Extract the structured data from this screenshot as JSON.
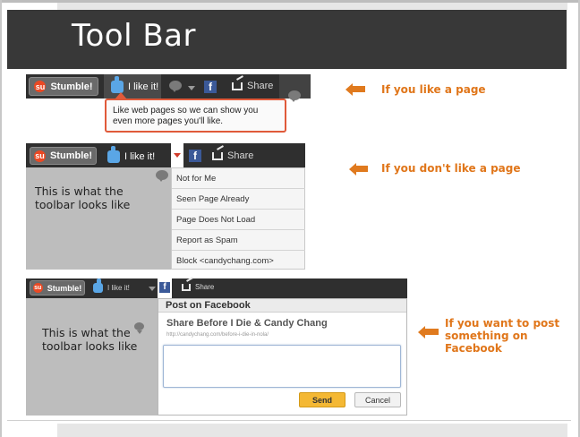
{
  "slide": {
    "title": "Tool Bar"
  },
  "toolbar": {
    "stumble_label": "Stumble!",
    "like_label": "I like it!",
    "share_label": "Share",
    "facebook_glyph": "f",
    "stumble_glyph": "su",
    "icons": [
      "stumbleupon-logo-icon",
      "thumbs-up-icon",
      "thumbs-down-icon",
      "chevron-down-icon",
      "facebook-icon",
      "share-icon",
      "comment-icon"
    ]
  },
  "tooltip": {
    "text": "Like web pages so we can show you even more pages you'll like."
  },
  "notes": {
    "like": "If you like a page",
    "dislike": "If you don't like a page",
    "facebook_line1": "If you want to post",
    "facebook_line2": "something on Facebook"
  },
  "panels": {
    "caption_1": "This is what the toolbar looks like",
    "caption_2": "This is what the toolbar looks like"
  },
  "dropdown": {
    "items": [
      "Not for Me",
      "Seen Page Already",
      "Page Does Not Load",
      "Report as Spam",
      "Block <candychang.com>"
    ]
  },
  "facebook_dialog": {
    "header": "Post on Facebook",
    "title": "Share Before I Die & Candy Chang",
    "url": "http://candychang.com/before-i-die-in-nola/",
    "textarea_value": "",
    "send_label": "Send",
    "cancel_label": "Cancel"
  },
  "colors": {
    "accent_orange": "#e07a1e",
    "title_bar": "#383838",
    "facebook_blue": "#3b5998",
    "stumble_red": "#eb4924",
    "send_yellow": "#f4b834"
  }
}
